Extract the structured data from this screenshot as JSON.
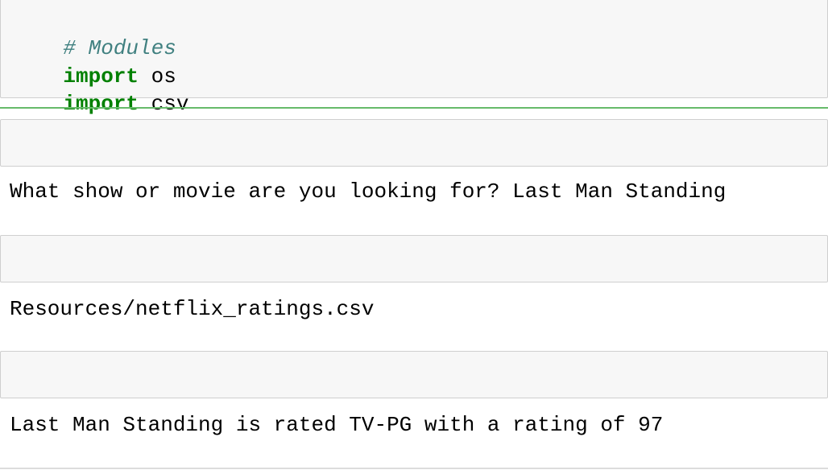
{
  "code_cell": {
    "comment": "# Modules",
    "lines": [
      {
        "keyword": "import",
        "module": " os"
      },
      {
        "keyword": "import",
        "module": " csv"
      }
    ]
  },
  "outputs": [
    {
      "text": "What show or movie are you looking for? Last Man Standing"
    },
    {
      "text": "Resources/netflix_ratings.csv"
    },
    {
      "text": "Last Man Standing is rated TV-PG with a rating of 97"
    }
  ],
  "colors": {
    "comment": "#408080",
    "keyword": "#008000",
    "cell_background": "#f7f7f7",
    "cell_border": "#cfcfcf",
    "selected_divider": "#66bb6a"
  }
}
